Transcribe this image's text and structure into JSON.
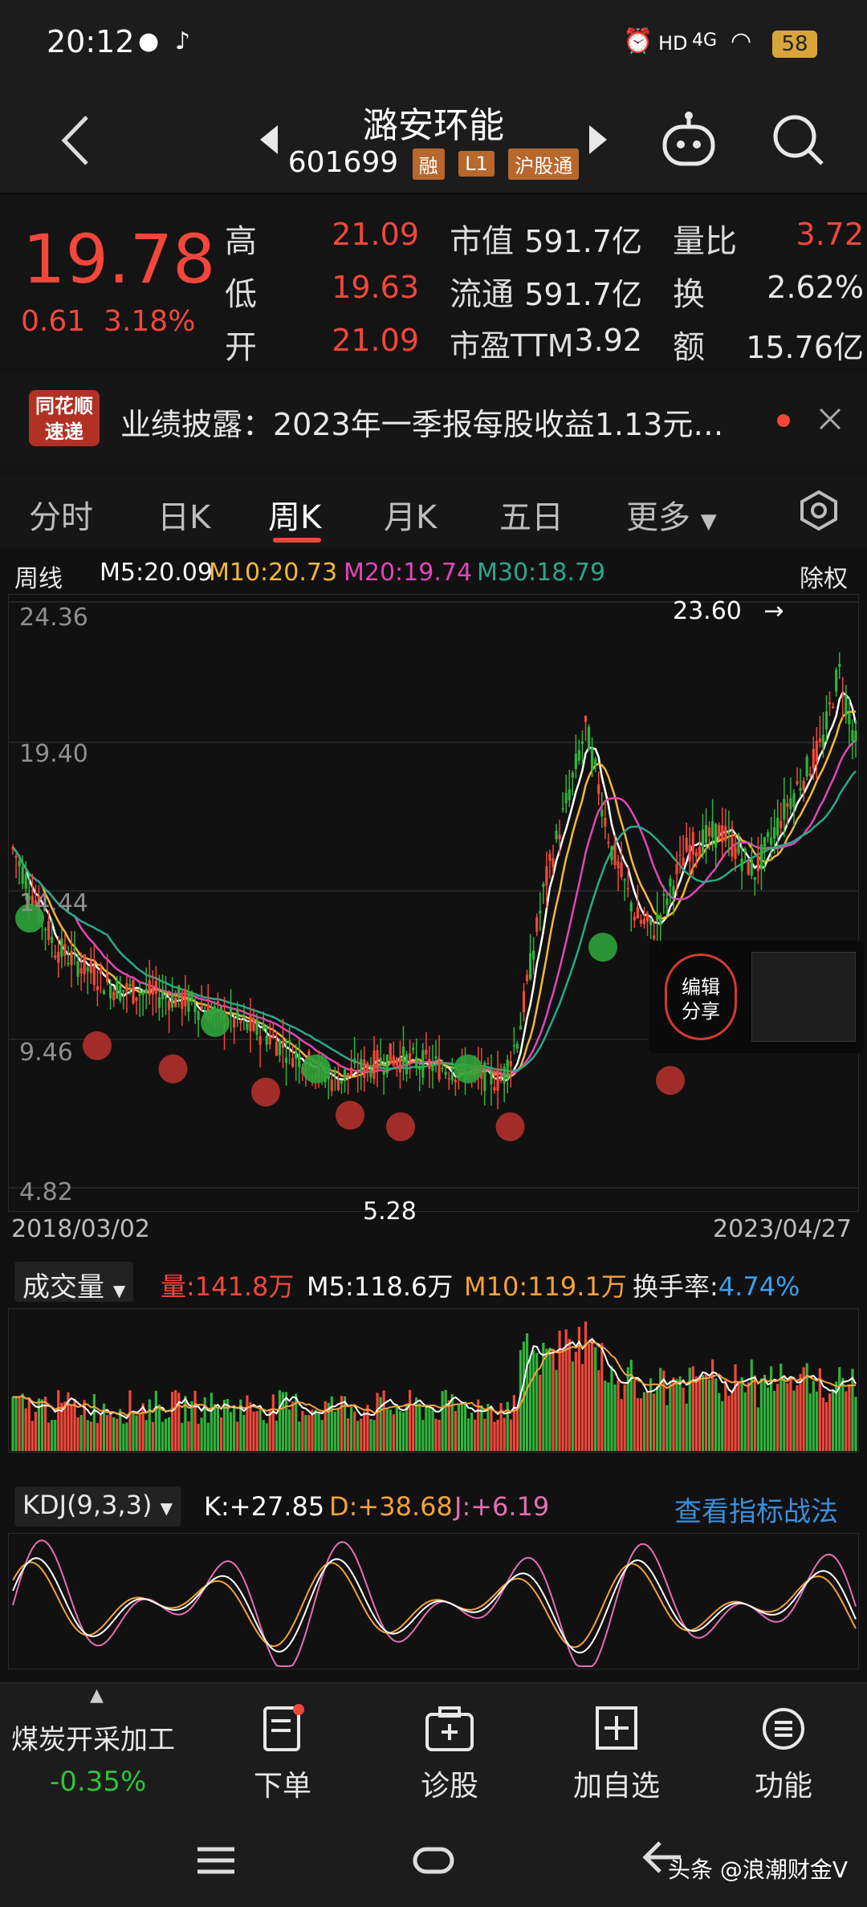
{
  "status_bar": {
    "time": "20:12",
    "battery": "58",
    "network": "4G"
  },
  "header": {
    "stock_name": "潞安环能",
    "stock_code": "601699",
    "tags": [
      "融",
      "L1",
      "沪股通"
    ]
  },
  "quote": {
    "price": "19.78",
    "change": "0.61",
    "change_pct": "3.18%",
    "rows": [
      {
        "l1": "高",
        "v1": "21.09",
        "l2": "市值",
        "v2": "591.7亿",
        "l3": "量比",
        "v3": "3.72"
      },
      {
        "l1": "低",
        "v1": "19.63",
        "l2": "流通",
        "v2": "591.7亿",
        "l3": "换",
        "v3": "2.62%"
      },
      {
        "l1": "开",
        "v1": "21.09",
        "l2": "市盈TTM",
        "v2": "3.92",
        "l3": "额",
        "v3": "15.76亿"
      }
    ]
  },
  "news": {
    "logo_top": "同花顺",
    "logo_bottom": "速递",
    "text": "业绩披露：2023年一季报每股收益1.13元…"
  },
  "tabs": [
    "分时",
    "日K",
    "周K",
    "月K",
    "五日",
    "更多"
  ],
  "active_tab": "周K",
  "kline": {
    "period": "周线",
    "ma5": "M5:20.09",
    "ma10": "M10:20.73",
    "ma20": "M20:19.74",
    "ma30": "M30:18.79",
    "rights": "除权",
    "y_labels": [
      "24.36",
      "19.40",
      "14.44",
      "9.46",
      "4.82"
    ],
    "high_mark": "23.60",
    "low_mark": "5.28",
    "date_start": "2018/03/02",
    "date_end": "2023/04/27",
    "share_label_1": "编辑",
    "share_label_2": "分享"
  },
  "volume": {
    "name": "成交量",
    "vol": "量:141.8万",
    "m5": "M5:118.6万",
    "m10": "M10:119.1万",
    "turnover_label": "换手率:",
    "turnover_value": "4.74%"
  },
  "kdj": {
    "name": "KDJ(9,3,3)",
    "k": "K:+27.85",
    "d": "D:+38.68",
    "j": "J:+6.19",
    "link": "查看指标战法"
  },
  "bottom": {
    "sector_name": "煤炭开采加工",
    "sector_change": "-0.35%",
    "items": [
      "下单",
      "诊股",
      "加自选",
      "功能"
    ]
  },
  "watermark": "头条 @浪潮财金V",
  "colors": {
    "up": "#f2473a",
    "down": "#2fb33b",
    "ma5": "#ffffff",
    "ma10": "#f5b83a",
    "ma20": "#e046b8",
    "ma30": "#2aa889"
  }
}
